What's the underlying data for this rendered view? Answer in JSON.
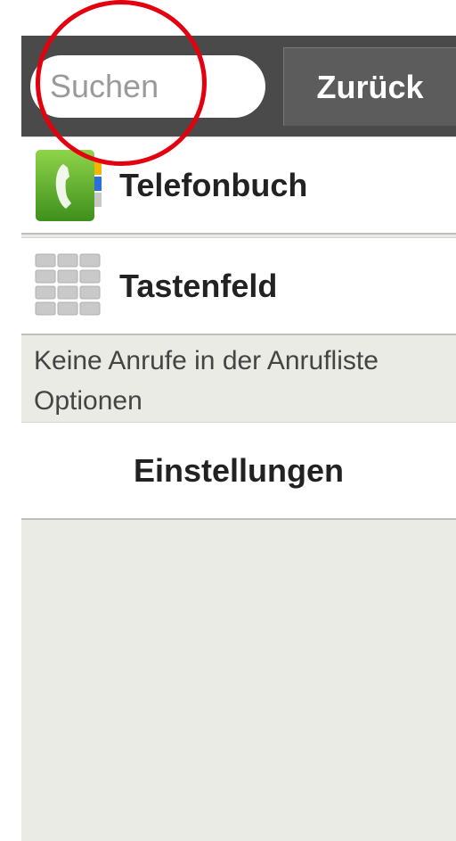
{
  "toolbar": {
    "search_placeholder": "Suchen",
    "back_label": "Zurück"
  },
  "menu": {
    "phonebook_label": "Telefonbuch",
    "keypad_label": "Tastenfeld"
  },
  "call_log": {
    "empty_text": "Keine Anrufe in der Anrufliste"
  },
  "options": {
    "header": "Optionen",
    "settings_label": "Einstellungen"
  },
  "colors": {
    "toolbar_background": "#4a4a4a",
    "screen_background": "#ebebe6",
    "highlight_circle": "#e3000f",
    "phone_icon_green": "#5ab52c"
  },
  "icons": {
    "phonebook": "phone-handset-icon",
    "keypad": "keypad-icon"
  }
}
